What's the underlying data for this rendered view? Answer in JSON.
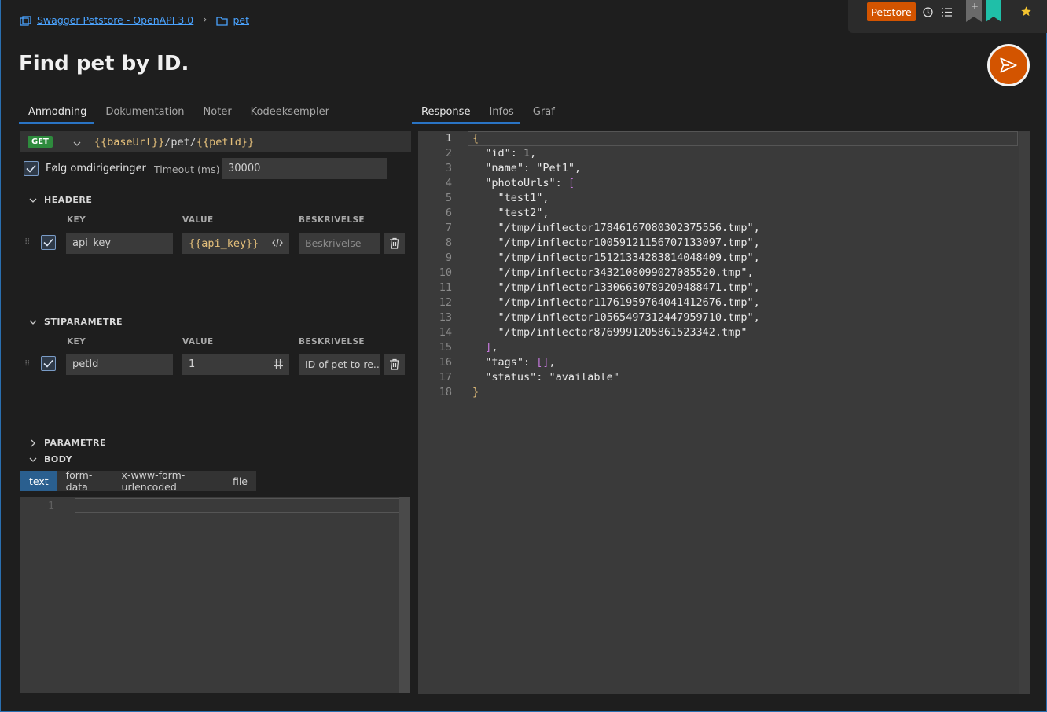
{
  "breadcrumb": {
    "collection": "Swagger Petstore - OpenAPI 3.0",
    "folder": "pet"
  },
  "topbar": {
    "environment": "Petstore",
    "plus": "+"
  },
  "title": "Find pet by ID.",
  "request_tabs": [
    "Anmodning",
    "Dokumentation",
    "Noter",
    "Kodeeksempler"
  ],
  "response_tabs": [
    "Response",
    "Infos",
    "Graf"
  ],
  "request": {
    "method": "GET",
    "url_parts": [
      "{{baseUrl}}",
      "/pet/",
      "{{petId}}"
    ],
    "follow_redirects_label": "Følg omdirigeringer",
    "follow_redirects": true,
    "timeout_label": "Timeout (ms)",
    "timeout_value": "30000"
  },
  "headers": {
    "title": "HEADERE",
    "col_key": "KEY",
    "col_value": "VALUE",
    "col_desc": "BESKRIVELSE",
    "row": {
      "key": "api_key",
      "value": "{{api_key}}",
      "desc_placeholder": "Beskrivelse"
    }
  },
  "path_params": {
    "title": "STIPARAMETRE",
    "col_key": "KEY",
    "col_value": "VALUE",
    "col_desc": "BESKRIVELSE",
    "row": {
      "key": "petId",
      "value": "1",
      "desc": "ID of pet to re..."
    }
  },
  "params_title": "PARAMETRE",
  "body": {
    "title": "BODY",
    "types": [
      "text",
      "form-data",
      "x-www-form-urlencoded",
      "file"
    ],
    "active_type": "text",
    "line_number": "1"
  },
  "response": {
    "line_numbers": [
      "1",
      "2",
      "3",
      "4",
      "5",
      "6",
      "7",
      "8",
      "9",
      "10",
      "11",
      "12",
      "13",
      "14",
      "15",
      "16",
      "17",
      "18"
    ],
    "lines": [
      "{",
      "  \"id\": 1,",
      "  \"name\": \"Pet1\",",
      "  \"photoUrls\": [",
      "    \"test1\",",
      "    \"test2\",",
      "    \"/tmp/inflector17846167080302375556.tmp\",",
      "    \"/tmp/inflector10059121156707133097.tmp\",",
      "    \"/tmp/inflector15121334283814048409.tmp\",",
      "    \"/tmp/inflector3432108099027085520.tmp\",",
      "    \"/tmp/inflector13306630789209488471.tmp\",",
      "    \"/tmp/inflector11761959764041412676.tmp\",",
      "    \"/tmp/inflector10565497312447959710.tmp\",",
      "    \"/tmp/inflector8769991205861523342.tmp\"",
      "  ],",
      "  \"tags\": [],",
      "  \"status\": \"available\"",
      "}"
    ]
  },
  "colors": {
    "accent": "#2a74c4",
    "brand": "#d35400",
    "get": "#2e8b3d",
    "bookmark": "#1fbfa8"
  }
}
